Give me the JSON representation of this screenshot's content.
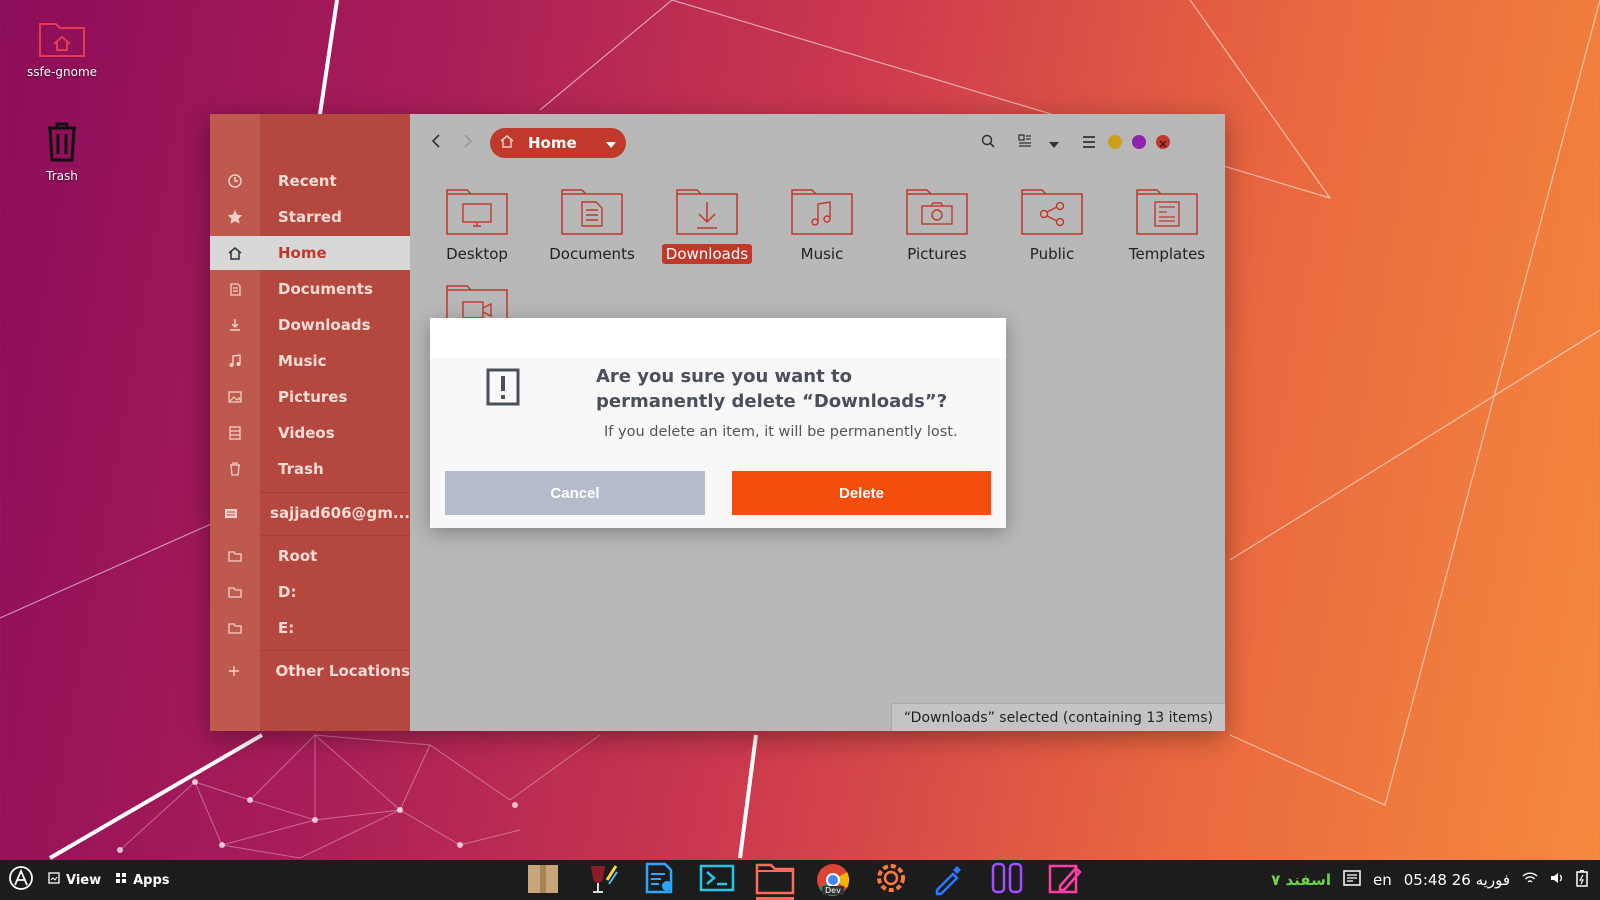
{
  "desktop": {
    "icons": [
      {
        "label": "ssfe-gnome",
        "icon": "home-folder-icon"
      },
      {
        "label": "Trash",
        "icon": "trash-icon"
      }
    ]
  },
  "window": {
    "path_label": "Home",
    "sidebar": {
      "items": [
        {
          "label": "Recent",
          "icon": "clock-icon"
        },
        {
          "label": "Starred",
          "icon": "star-icon"
        },
        {
          "label": "Home",
          "icon": "home-icon",
          "active": true
        },
        {
          "label": "Documents",
          "icon": "documents-icon"
        },
        {
          "label": "Downloads",
          "icon": "download-icon"
        },
        {
          "label": "Music",
          "icon": "music-icon"
        },
        {
          "label": "Pictures",
          "icon": "picture-icon"
        },
        {
          "label": "Videos",
          "icon": "video-icon"
        },
        {
          "label": "Trash",
          "icon": "trash-icon"
        },
        {
          "label": "sajjad606@gm...",
          "icon": "drive-icon"
        },
        {
          "label": "Root",
          "icon": "folder-icon"
        },
        {
          "label": "D:",
          "icon": "folder-icon"
        },
        {
          "label": "E:",
          "icon": "folder-icon"
        },
        {
          "label": "Other Locations",
          "icon": "plus-icon"
        }
      ]
    },
    "files": [
      {
        "label": "Desktop",
        "icon": "desktop-folder-icon"
      },
      {
        "label": "Documents",
        "icon": "documents-folder-icon"
      },
      {
        "label": "Downloads",
        "icon": "downloads-folder-icon",
        "selected": true
      },
      {
        "label": "Music",
        "icon": "music-folder-icon"
      },
      {
        "label": "Pictures",
        "icon": "pictures-folder-icon"
      },
      {
        "label": "Public",
        "icon": "public-folder-icon"
      },
      {
        "label": "Templates",
        "icon": "templates-folder-icon"
      },
      {
        "label": "",
        "icon": "videos-folder-icon"
      }
    ],
    "status_text": "“Downloads” selected  (containing 13 items)",
    "window_colors": {
      "minimize": "#c9a21a",
      "maximize": "#8e24aa",
      "close": "#c0392b"
    }
  },
  "dialog": {
    "title": "Are you sure you want to permanently delete “Downloads”?",
    "message": "If you delete an item, it will be permanently lost.",
    "cancel_label": "Cancel",
    "delete_label": "Delete",
    "colors": {
      "cancel": "#b4bbcb",
      "delete": "#f24d0a"
    }
  },
  "taskbar": {
    "view_label": "View",
    "apps_label": "Apps",
    "dock_apps": [
      "package-icon",
      "wine-icon",
      "text-editor-icon",
      "terminal-icon",
      "files-icon",
      "chrome-dev-icon",
      "settings-icon",
      "color-picker-icon",
      "switch-icon",
      "draw-icon"
    ],
    "dock_badge": "Dev",
    "persian_date_short": "۷ اسفند",
    "lang": "en",
    "clock": "05:48  26 فوریه"
  }
}
